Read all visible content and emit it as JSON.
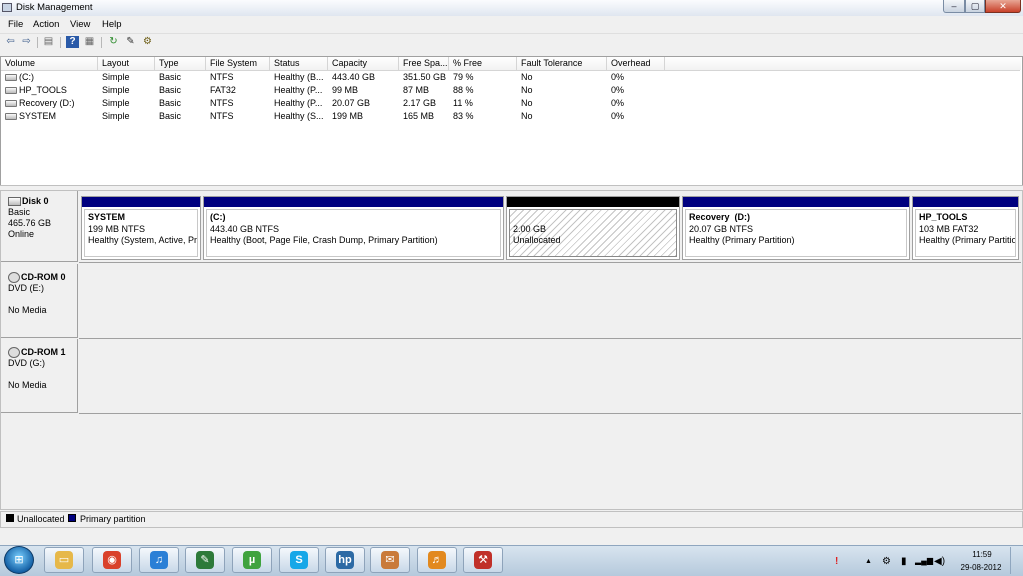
{
  "window": {
    "title": "Disk Management",
    "controls": {
      "minimize": "–",
      "maximize": "▢",
      "close": "✕"
    }
  },
  "menu": [
    "File",
    "Action",
    "View",
    "Help"
  ],
  "toolbar": {
    "icons": [
      "back-arrow-icon",
      "forward-arrow-icon",
      "console-tree-icon",
      "help-icon",
      "list-view-icon",
      "refresh-icon",
      "properties-icon",
      "settings-icon"
    ],
    "glyphs": [
      "⇦",
      "⇨",
      "▤",
      "?",
      "▦",
      "↻",
      "✎",
      "⚙"
    ]
  },
  "volumes": {
    "columns": [
      "Volume",
      "Layout",
      "Type",
      "File System",
      "Status",
      "Capacity",
      "Free Spa...",
      "% Free",
      "Fault Tolerance",
      "Overhead"
    ],
    "rows": [
      [
        "(C:)",
        "Simple",
        "Basic",
        "NTFS",
        "Healthy (B...",
        "443.40 GB",
        "351.50 GB",
        "79 %",
        "No",
        "0%"
      ],
      [
        "HP_TOOLS",
        "Simple",
        "Basic",
        "FAT32",
        "Healthy (P...",
        "99 MB",
        "87 MB",
        "88 %",
        "No",
        "0%"
      ],
      [
        "Recovery (D:)",
        "Simple",
        "Basic",
        "NTFS",
        "Healthy (P...",
        "20.07 GB",
        "2.17 GB",
        "11 %",
        "No",
        "0%"
      ],
      [
        "SYSTEM",
        "Simple",
        "Basic",
        "NTFS",
        "Healthy (S...",
        "199 MB",
        "165 MB",
        "83 %",
        "No",
        "0%"
      ]
    ]
  },
  "disks": [
    {
      "name": "Disk 0",
      "lines": [
        "Basic",
        "465.76 GB",
        "Online"
      ]
    },
    {
      "name": "CD-ROM 0",
      "lines": [
        "DVD (E:)",
        "",
        "No Media"
      ]
    },
    {
      "name": "CD-ROM 1",
      "lines": [
        "DVD (G:)",
        "",
        "No Media"
      ]
    }
  ],
  "partitions": [
    {
      "name": "SYSTEM",
      "size": "199 MB NTFS",
      "status": "Healthy (System, Active, Prir"
    },
    {
      "name": "(C:)",
      "size": "443.40 GB NTFS",
      "status": "Healthy (Boot, Page File, Crash Dump, Primary Partition)"
    },
    {
      "name": "",
      "size": "2.00 GB",
      "status": "Unallocated"
    },
    {
      "name": "Recovery  (D:)",
      "size": "20.07 GB NTFS",
      "status": "Healthy (Primary Partition)"
    },
    {
      "name": "HP_TOOLS",
      "size": "103 MB FAT32",
      "status": "Healthy (Primary Partitio"
    }
  ],
  "legend": [
    {
      "label": "Unallocated",
      "color": "#000000"
    },
    {
      "label": "Primary partition",
      "color": "#00007f"
    }
  ],
  "taskbar": {
    "start": "⊞",
    "apps": [
      {
        "name": "explorer",
        "glyph": "▭",
        "color": "#e6b84a"
      },
      {
        "name": "chrome",
        "glyph": "◉",
        "color": "#d9412b"
      },
      {
        "name": "itunes",
        "glyph": "♫",
        "color": "#2a7fd6"
      },
      {
        "name": "notepad",
        "glyph": "✎",
        "color": "#2d7a3a"
      },
      {
        "name": "utorrent",
        "glyph": "µ",
        "color": "#3fa33f"
      },
      {
        "name": "skype",
        "glyph": "S",
        "color": "#17a7e8"
      },
      {
        "name": "hp",
        "glyph": "hp",
        "color": "#2c6aa5"
      },
      {
        "name": "message",
        "glyph": "✉",
        "color": "#c97a3a"
      },
      {
        "name": "music",
        "glyph": "♬",
        "color": "#e2891f"
      },
      {
        "name": "toolbox",
        "glyph": "⚒",
        "color": "#c0302a"
      }
    ],
    "tray": [
      "!",
      "▲",
      "⚙",
      "▮",
      "▂▄▆",
      "◀)"
    ],
    "time": "11:59",
    "date": "29-08-2012"
  }
}
